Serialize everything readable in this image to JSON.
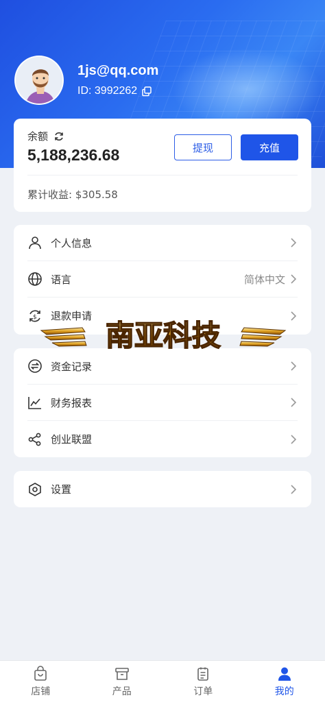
{
  "profile": {
    "email": "1js@qq.com",
    "id_text": "ID: 3992262"
  },
  "balance": {
    "label": "余额",
    "value": "5,188,236.68",
    "withdraw_label": "提现",
    "recharge_label": "充值",
    "earnings_text": "累计收益: $305.58"
  },
  "menu_group_1": [
    {
      "label": "个人信息",
      "icon": "user-icon"
    },
    {
      "label": "语言",
      "value": "简体中文",
      "icon": "globe-icon"
    },
    {
      "label": "退款申请",
      "icon": "refund-icon"
    }
  ],
  "menu_group_2": [
    {
      "label": "资金记录",
      "icon": "exchange-icon"
    },
    {
      "label": "财务报表",
      "icon": "chart-icon"
    },
    {
      "label": "创业联盟",
      "icon": "share-icon"
    }
  ],
  "menu_group_3": [
    {
      "label": "设置",
      "icon": "settings-icon"
    }
  ],
  "watermark": {
    "text": "南亚科技"
  },
  "tabbar": [
    {
      "label": "店铺",
      "icon": "shop-icon",
      "active": false
    },
    {
      "label": "产品",
      "icon": "box-icon",
      "active": false
    },
    {
      "label": "订单",
      "icon": "order-icon",
      "active": false
    },
    {
      "label": "我的",
      "icon": "person-icon",
      "active": true
    }
  ],
  "colors": {
    "accent": "#1f55e8",
    "header_blue": "#2a6cf0",
    "background": "#eef1f6"
  }
}
